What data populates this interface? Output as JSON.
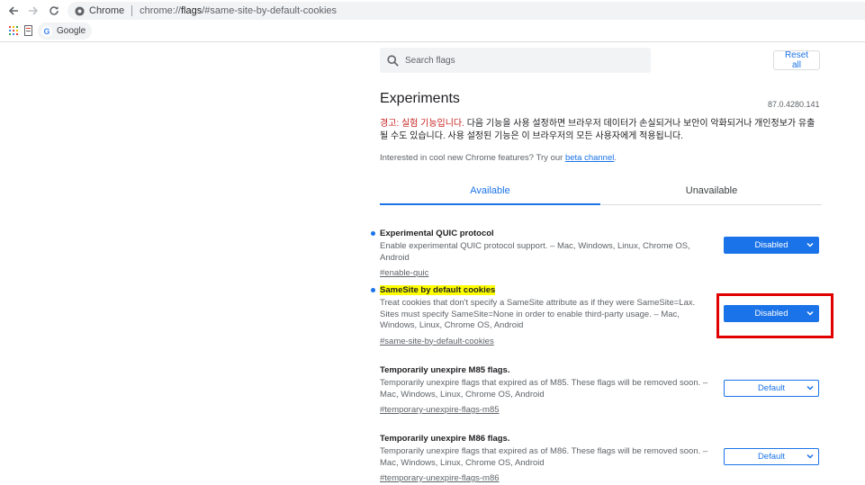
{
  "browser": {
    "chip_label": "Chrome",
    "url_prefix": "chrome://",
    "url_host": "flags",
    "url_rest": "/#same-site-by-default-cookies",
    "bookmark_google": "Google",
    "google_letter": "G"
  },
  "flags_page": {
    "search_placeholder": "Search flags",
    "reset_label": "Reset all",
    "title": "Experiments",
    "version": "87.0.4280.141",
    "warning_red": "경고: 실험 기능입니다.",
    "warning_rest": " 다음 기능을 사용 설정하면 브라우저 데이터가 손실되거나 보안이 악화되거나 개인정보가 유출될 수도 있습니다. 사용 설정된 기능은 이 브라우저의 모든 사용자에게 적용됩니다.",
    "interested_text": "Interested in cool new Chrome features? Try our ",
    "interested_link": "beta channel",
    "interested_end": ".",
    "tab_available": "Available",
    "tab_unavailable": "Unavailable"
  },
  "experiments": [
    {
      "name": "Experimental QUIC protocol",
      "desc": "Enable experimental QUIC protocol support. – Mac, Windows, Linux, Chrome OS, Android",
      "link": "#enable-quic",
      "value": "Disabled"
    },
    {
      "name": "SameSite by default cookies",
      "desc": "Treat cookies that don't specify a SameSite attribute as if they were SameSite=Lax. Sites must specify SameSite=None in order to enable third-party usage. – Mac, Windows, Linux, Chrome OS, Android",
      "link": "#same-site-by-default-cookies",
      "value": "Disabled"
    },
    {
      "name": "Temporarily unexpire M85 flags.",
      "desc": "Temporarily unexpire flags that expired as of M85. These flags will be removed soon. – Mac, Windows, Linux, Chrome OS, Android",
      "link": "#temporary-unexpire-flags-m85",
      "value": "Default"
    },
    {
      "name": "Temporarily unexpire M86 flags.",
      "desc": "Temporarily unexpire flags that expired as of M86. These flags will be removed soon. – Mac, Windows, Linux, Chrome OS, Android",
      "link": "#temporary-unexpire-flags-m86",
      "value": "Default"
    }
  ],
  "colors": {
    "accent": "#1a73e8",
    "warning_red": "#c5221f",
    "highlight_yellow": "#ffff00",
    "annotation_red": "#e00000"
  },
  "icons": {
    "back": "back-arrow-icon",
    "forward": "forward-arrow-icon",
    "reload": "reload-icon",
    "site_info": "chrome-site-icon",
    "apps": "apps-grid-icon",
    "search": "search-icon",
    "dropdown": "chevron-down-icon"
  }
}
